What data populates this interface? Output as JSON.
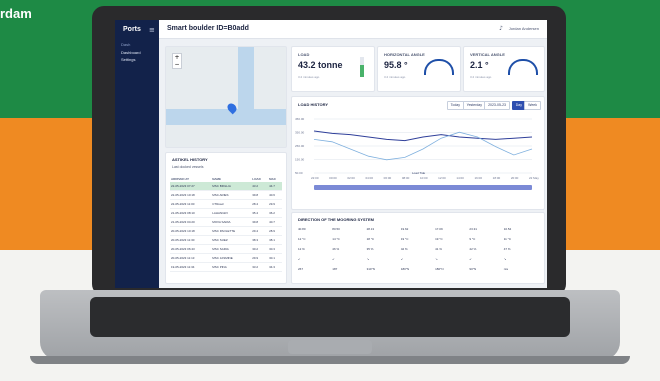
{
  "brand_text": "rdam",
  "app": {
    "logo": "Ports",
    "page_title": "Smart boulder ID=B0add",
    "user": "Jordan Andersen"
  },
  "sidebar": {
    "section": "Dash",
    "items": [
      {
        "label": "Dashboard"
      },
      {
        "label": "Settings"
      }
    ]
  },
  "metrics": [
    {
      "label": "LOAD",
      "value": "43.2 tonne",
      "sub": "3.2 minutes ago",
      "fill_fraction": 0.6
    },
    {
      "label": "HORIZONTAL ANGLE",
      "value": "95.8 °",
      "sub": "3.2 minutes ago"
    },
    {
      "label": "VERTICAL ANGLE",
      "value": "2.1 °",
      "sub": "3.2 minutes ago"
    }
  ],
  "chart": {
    "title": "LOAD HISTORY",
    "buttons": [
      {
        "label": "Today"
      },
      {
        "label": "Yesterday"
      },
      {
        "label": "2023-05-23"
      },
      {
        "label": "Day"
      },
      {
        "label": "Week"
      }
    ],
    "y_ticks": [
      "450.00",
      "350.00",
      "250.00",
      "150.00",
      "50.00"
    ],
    "x_ticks": [
      "22:00",
      "00:00",
      "02:00",
      "04:00",
      "06:00",
      "08:00",
      "10:00",
      "12:00",
      "14:00",
      "16:00",
      "18:00",
      "20:00",
      "22 May"
    ],
    "legend": "Load  Tide",
    "accent": "#2f4fb0"
  },
  "chart_data": {
    "type": "line",
    "x": [
      "22:00",
      "00:00",
      "02:00",
      "04:00",
      "06:00",
      "08:00",
      "10:00",
      "12:00",
      "14:00",
      "16:00",
      "18:00",
      "20:00",
      "22:00"
    ],
    "series": [
      {
        "name": "Load",
        "values": [
          350,
          330,
          320,
          300,
          280,
          270,
          300,
          320,
          300,
          290,
          280,
          290,
          300
        ]
      },
      {
        "name": "Tide",
        "values": [
          280,
          260,
          200,
          140,
          110,
          130,
          200,
          290,
          340,
          300,
          220,
          150,
          200
        ]
      }
    ],
    "ylim": [
      0,
      450
    ]
  },
  "history": {
    "title": "ASTIKEL HISTORY",
    "subtitle": "Last docked vessels",
    "columns": [
      "ARRIVED AT",
      "NAME",
      "LOAD",
      "MAX"
    ],
    "rows": [
      [
        "22-05-2023 07:27",
        "MSC BRILLIA",
        "43.2",
        "44.7"
      ],
      [
        "22-05-2023 10:18",
        "MSC ARIES",
        "39.8",
        "40.6"
      ],
      [
        "22-05-2023 11:00",
        "CTRoad",
        "28.4",
        "29.9"
      ],
      [
        "21-05-2023 08:10",
        "LAHANGRI",
        "35.4",
        "36.2"
      ],
      [
        "21-05-2023 04:20",
        "MOVA SARIA",
        "39.8",
        "40.7"
      ],
      [
        "20-05-2023 10:18",
        "MSC PAOLETTE",
        "29.4",
        "28.9"
      ],
      [
        "20-05-2023 11:30",
        "MSC SUEZ",
        "38.3",
        "38.1"
      ],
      [
        "20-05-2023 06:43",
        "MSC SARIA",
        "30.2",
        "30.3"
      ],
      [
        "20-05-2023 11:13",
        "MSC JASMINE",
        "29.9",
        "30.1"
      ],
      [
        "19-05-2023 11:34",
        "MSC PINA",
        "33.2",
        "34.3"
      ]
    ],
    "highlight_color": "#cde9d6"
  },
  "direction": {
    "title": "DIRECTION OF THE MOORING SYSTEM",
    "rows": [
      [
        "40.80",
        "80.50",
        "28.13",
        "19.62",
        "17.09",
        "23.31",
        "10.54"
      ],
      [
        "12 °C",
        "14 °C",
        "18 °C",
        "19 °C",
        "19 °C",
        "9 °C",
        "11 °C"
      ],
      [
        "12 %",
        "46 %",
        "35 %",
        "42 %",
        "41 %",
        "42 %",
        "47 %"
      ],
      [
        "↙",
        "↙",
        "↘",
        "↙",
        "↘",
        "↙",
        "↘"
      ],
      [
        "267",
        "187",
        "310°N",
        "180°N",
        "180°N",
        "90°N",
        "n/a"
      ]
    ]
  }
}
